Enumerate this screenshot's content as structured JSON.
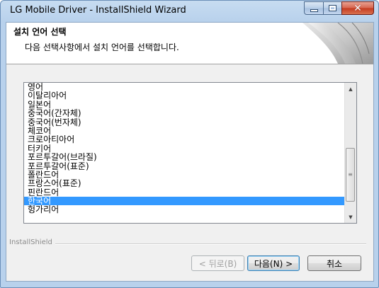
{
  "window": {
    "title": "LG Mobile Driver - InstallShield Wizard"
  },
  "header": {
    "title": "설치 언어 선택",
    "subtitle": "다음 선택사항에서 설치 언어를 선택합니다."
  },
  "language_list": {
    "items": [
      "영어",
      "이탈리아어",
      "일본어",
      "중국어(간자체)",
      "중국어(번자체)",
      "체코어",
      "크로아티아어",
      "터키어",
      "포르투갈어(브라질)",
      "포르투갈어(표준)",
      "폴란드어",
      "프랑스어(표준)",
      "핀란드어",
      "한국어",
      "헝가리어"
    ],
    "selected": "한국어"
  },
  "footer": {
    "brand": "InstallShield",
    "back_label": "< 뒤로(B)",
    "next_label": "다음(N) >",
    "cancel_label": "취소"
  },
  "colors": {
    "selection": "#3399ff",
    "close_button": "#c43a1f"
  }
}
